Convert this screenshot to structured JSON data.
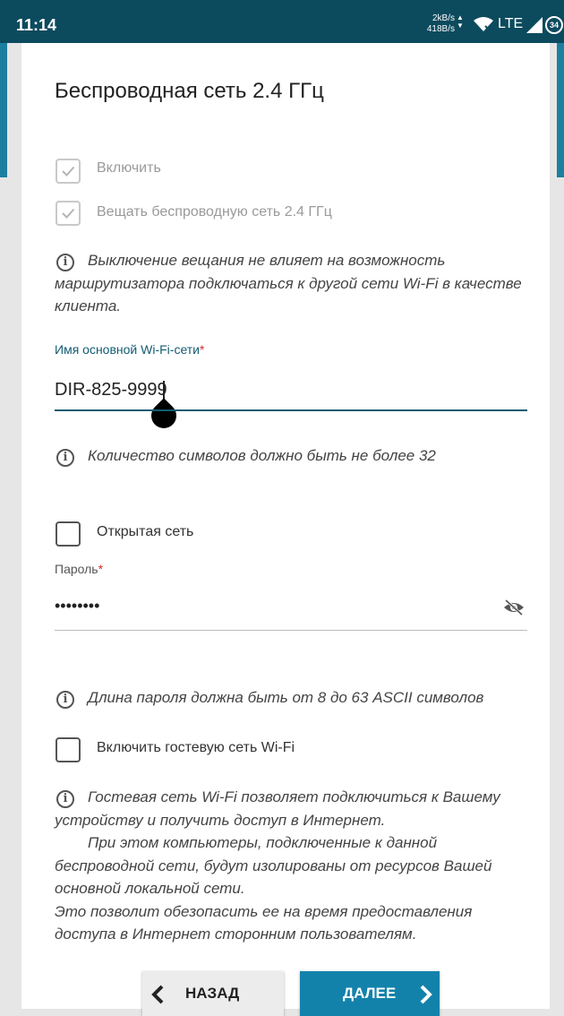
{
  "status_bar": {
    "time": "11:14",
    "upload_speed": "2kB/s",
    "download_speed": "418B/s",
    "network_type": "LTE",
    "battery": "34",
    "background_color": "#0c4a5e"
  },
  "page": {
    "title": "Беспроводная сеть 2.4 ГГц"
  },
  "enable": {
    "label": "Включить",
    "checked": true,
    "disabled": true
  },
  "broadcast": {
    "label": "Вещать беспроводную сеть 2.4 ГГц",
    "checked": true,
    "disabled": true
  },
  "info_broadcast": {
    "line1": "Выключение вещания не влияет на возможность",
    "line2": "маршрутизатора подключаться к другой сети Wi-Fi в качестве",
    "line3": "клиента."
  },
  "ssid": {
    "label": "Имя основной Wi-Fi-сети",
    "required_mark": "*",
    "value": "DIR-825-9999"
  },
  "info_ssid": {
    "text": "Количество символов должно быть не более 32"
  },
  "open_network": {
    "label": "Открытая сеть",
    "checked": false
  },
  "password": {
    "label": "Пароль",
    "required_mark": "*",
    "value": "••••••••",
    "visibility_icon": "eye-off-icon"
  },
  "info_password": {
    "text": "Длина пароля должна быть от 8 до 63 ASCII символов"
  },
  "guest_network": {
    "label": "Включить гостевую сеть Wi-Fi",
    "checked": false
  },
  "info_guest": {
    "line1": "Гостевая сеть Wi-Fi позволяет подключиться к Вашему",
    "line2": "устройству и получить доступ в Интернет.",
    "line3": "При этом компьютеры, подключенные к данной",
    "line4": "беспроводной сети, будут изолированы от ресурсов Вашей",
    "line5": "основной локальной сети.",
    "line6": "Это позволит обезопасить ее на время предоставления",
    "line7": "доступа в Интернет сторонним пользователям."
  },
  "buttons": {
    "back_label": "НАЗАД",
    "next_label": "ДАЛЕЕ"
  },
  "colors": {
    "accent": "#135c73",
    "primary_button": "#1382ab",
    "required": "#d32f2f",
    "side_band": "#1d7fa0"
  }
}
